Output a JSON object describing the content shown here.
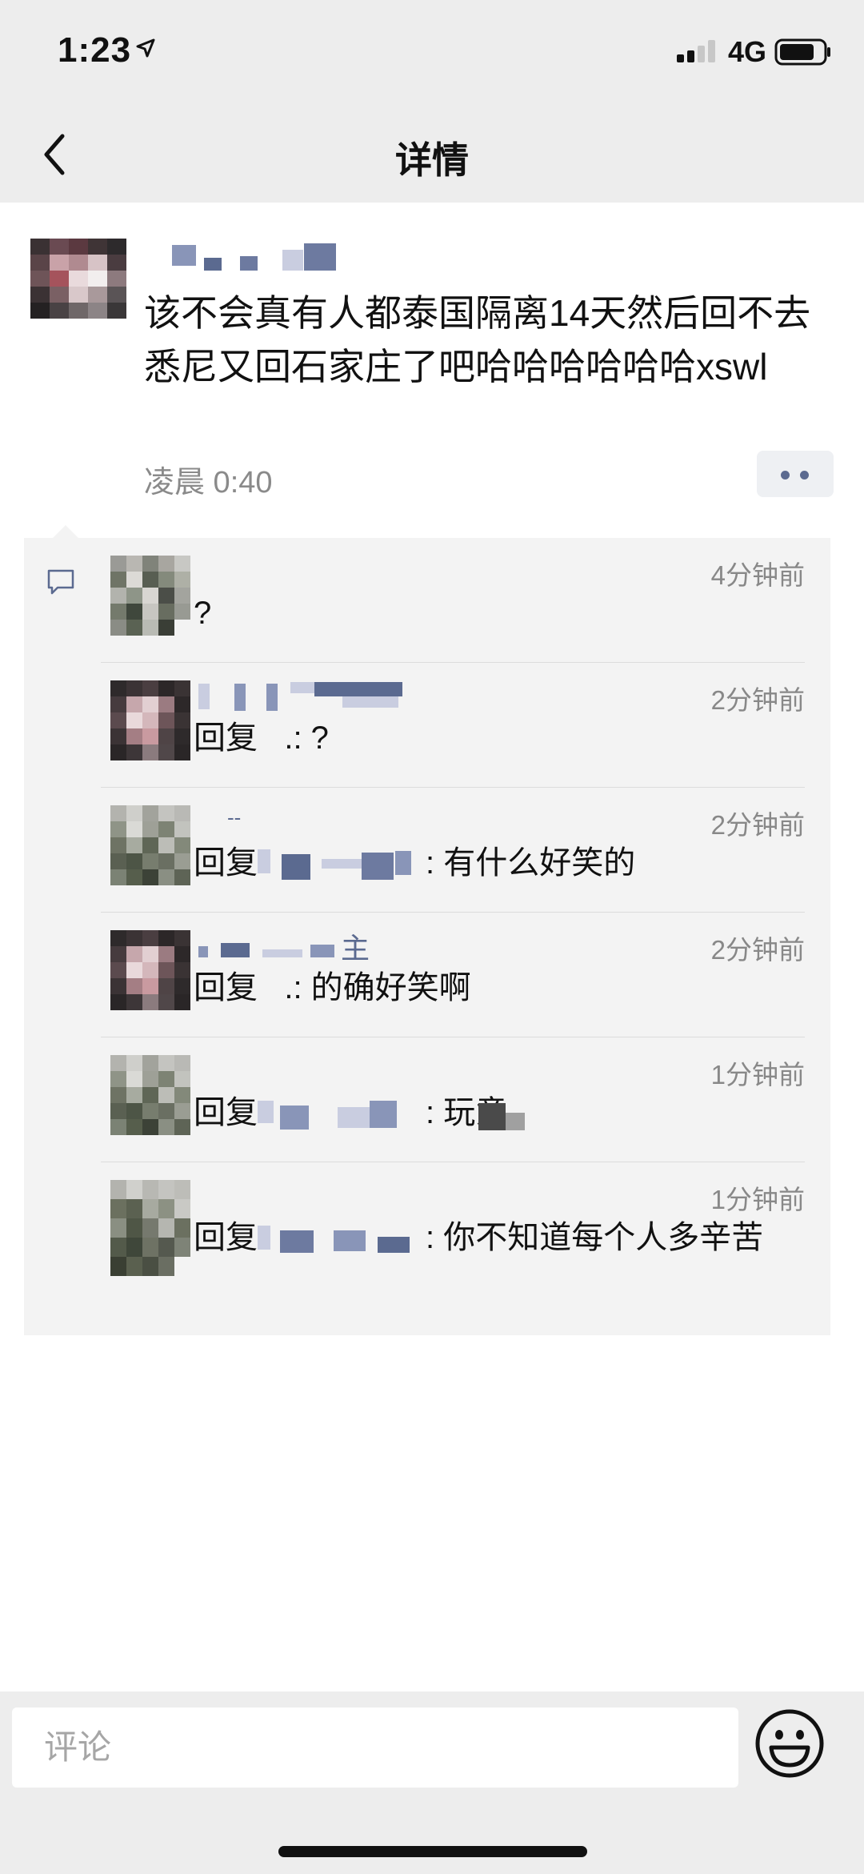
{
  "status_bar": {
    "time": "1:23",
    "network": "4G",
    "icons": [
      "location-arrow-icon",
      "signal-icon",
      "battery-icon"
    ]
  },
  "nav": {
    "title": "详情",
    "back_icon": "chevron-left-icon"
  },
  "post": {
    "text": "该不会真有人都泰国隔离14天然后回不去悉尼又回石家庄了吧哈哈哈哈哈哈xswl",
    "time": "凌晨 0:40",
    "more_icon": "more-dots-icon"
  },
  "comments_icon": "comment-bubble-icon",
  "comments": [
    {
      "time": "4分钟前",
      "prefix": "",
      "body": "?",
      "name_text": ""
    },
    {
      "time": "2分钟前",
      "prefix": "回复",
      "body": ".: ?",
      "name_text": ""
    },
    {
      "time": "2分钟前",
      "prefix": "回复",
      "body": ": 有什么好笑的",
      "name_text": "--"
    },
    {
      "time": "2分钟前",
      "prefix": "回复",
      "body": ".: 的确好笑啊",
      "name_text": "主"
    },
    {
      "time": "1分钟前",
      "prefix": "回复",
      "body": ": 玩意",
      "name_text": ""
    },
    {
      "time": "1分钟前",
      "prefix": "回复",
      "body": ": 你不知道每个人多辛苦",
      "name_text": ""
    }
  ],
  "bottom_bar": {
    "placeholder": "评论",
    "emoji_icon": "smiley-face-icon"
  },
  "colors": {
    "bar_bg": "#ededed",
    "comment_bg": "#f3f3f3",
    "name_blue": "#5b6a90",
    "meta_gray": "#8a8a8a"
  }
}
